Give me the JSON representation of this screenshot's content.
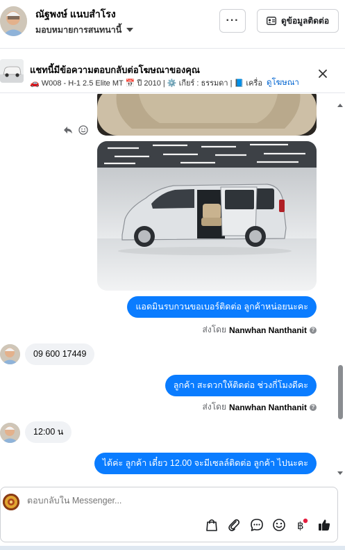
{
  "header": {
    "contact_name": "ณัฐพงษ์ แนบสำโรง",
    "assign_label": "มอบหมายการสนทนานี้",
    "more_label": "···",
    "contact_button_label": "ดูข้อมูลติดต่อ"
  },
  "ad": {
    "title": "แชทนี้มีข้อความตอบกลับต่อโฆษณาของคุณ",
    "detail": "🚗 W008 - H-1 2.5 Elite MT 📅 ปี 2010 | ⚙️ เกียร์ : ธรรมดา | 📘 เครื่อง…",
    "link_label": "ดูโฆษณา"
  },
  "messages": {
    "out1": "แอดมินรบกวนขอเบอร์ติดต่อ ลูกค้าหน่อยนะคะ",
    "sent_by_prefix": "ส่งโดย",
    "sender_name": "Nanwhan Nanthanit",
    "in1": "09 600 17449",
    "out2": "ลูกค้า สะดวกให้ติดต่อ ช่วงกี่โมงดีคะ",
    "in2": "12:00 น",
    "out3": "ได้ค่ะ  ลูกค้า เดี๋ยว 12.00 จะมีเซลล์ติดต่อ ลูกค้า ไปนะคะ"
  },
  "composer": {
    "placeholder": "ตอบกลับใน Messenger..."
  },
  "colors": {
    "accent": "#0a7cff",
    "link": "#0064d1",
    "incoming_bg": "#f0f2f5"
  },
  "icons": [
    "more-icon",
    "contact-card-icon",
    "close-icon",
    "reply-icon",
    "emoji-react-icon",
    "info-icon",
    "bag-icon",
    "attach-icon",
    "chat-reply-icon",
    "emoji-icon",
    "baht-icon",
    "thumbs-up-icon",
    "scroll-up-icon",
    "scroll-down-icon"
  ]
}
